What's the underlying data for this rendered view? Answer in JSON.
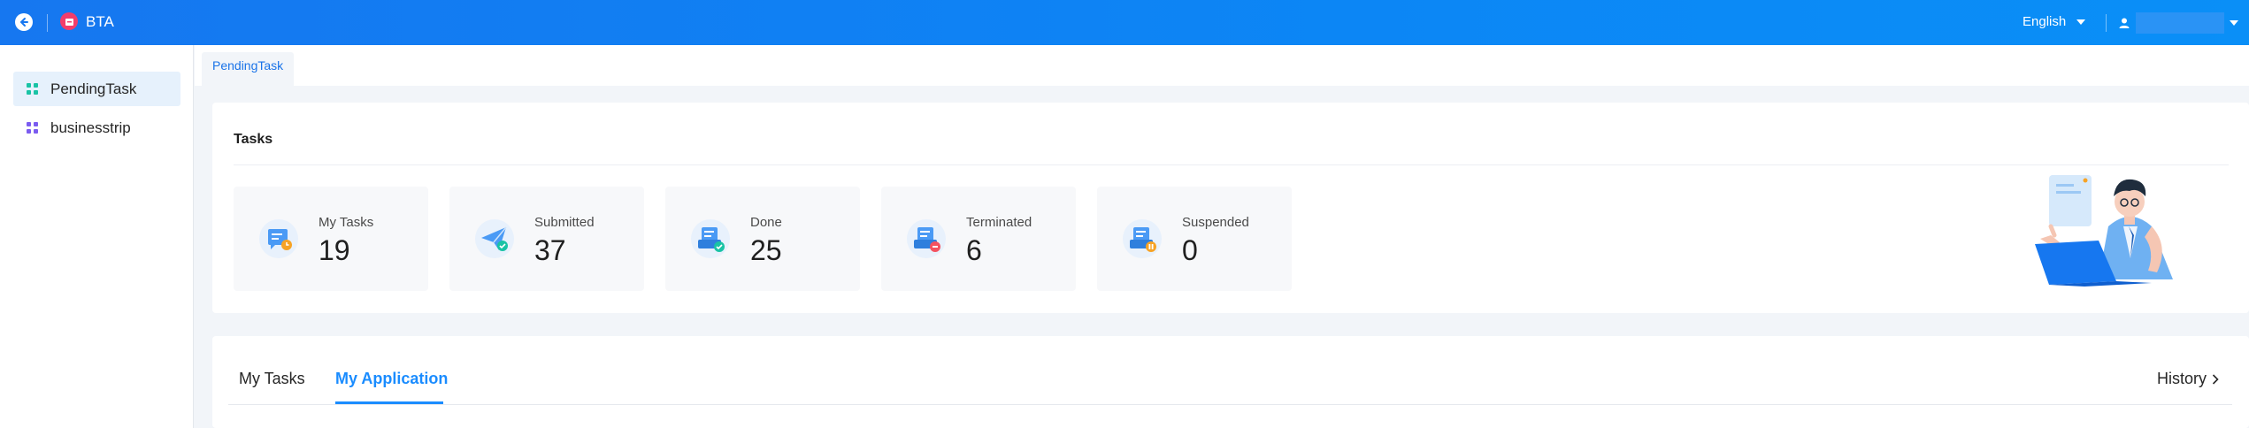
{
  "app": {
    "title": "BTA"
  },
  "header": {
    "language": "English",
    "user_name": ""
  },
  "sidebar": {
    "items": [
      {
        "label": "PendingTask",
        "active": true
      },
      {
        "label": "businesstrip",
        "active": false
      }
    ]
  },
  "page_tabs": [
    {
      "label": "PendingTask"
    }
  ],
  "tasks_card": {
    "title": "Tasks",
    "stats": [
      {
        "label": "My Tasks",
        "value": "19",
        "icon": "my-tasks-icon"
      },
      {
        "label": "Submitted",
        "value": "37",
        "icon": "submitted-icon"
      },
      {
        "label": "Done",
        "value": "25",
        "icon": "done-icon"
      },
      {
        "label": "Terminated",
        "value": "6",
        "icon": "terminated-icon"
      },
      {
        "label": "Suspended",
        "value": "0",
        "icon": "suspended-icon"
      }
    ]
  },
  "application_card": {
    "tabs": [
      {
        "label": "My Tasks",
        "active": false
      },
      {
        "label": "My Application",
        "active": true
      }
    ],
    "history_label": "History"
  },
  "colors": {
    "brand": "#1677f0",
    "accent": "#1a8cff",
    "app_logo": "#f23d6b",
    "active_sidebar_bg": "#e6f1fc",
    "done_badge": "#19c3a5",
    "terminated_badge": "#f4525f",
    "suspended_badge": "#f7a325"
  }
}
